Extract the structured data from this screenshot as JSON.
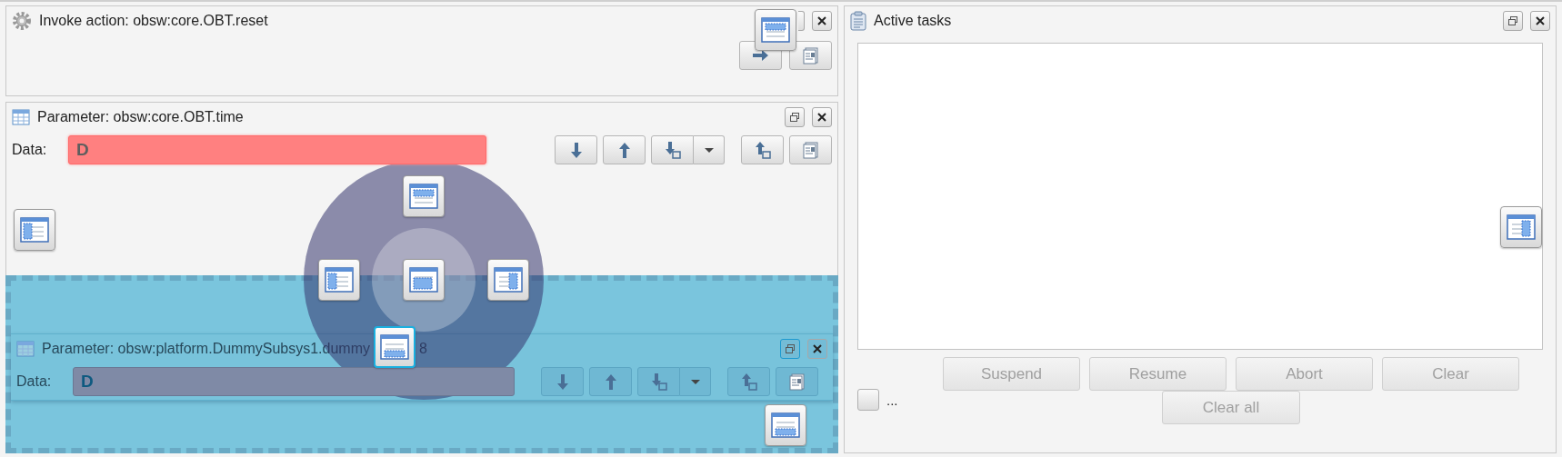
{
  "action_panel": {
    "title": "Invoke action: obsw:core.OBT.reset"
  },
  "parameter_panel": {
    "title": "Parameter: obsw:core.OBT.time",
    "data_label": "Data:",
    "data_value": "D",
    "invalid": true
  },
  "dragged_panel": {
    "title": "Parameter: obsw:platform.DummySubsys1.dummy",
    "title_end": "8",
    "data_label": "Data:",
    "data_value": "D"
  },
  "tasks_panel": {
    "title": "Active tasks",
    "checkbox": {
      "checked": false,
      "label": "..."
    },
    "buttons": [
      {
        "label": "Suspend",
        "disabled": true
      },
      {
        "label": "Resume",
        "disabled": true
      },
      {
        "label": "Abort",
        "disabled": true
      },
      {
        "label": "Clear",
        "disabled": true
      }
    ],
    "bottom_button": {
      "label": "Clear all",
      "disabled": true
    }
  }
}
